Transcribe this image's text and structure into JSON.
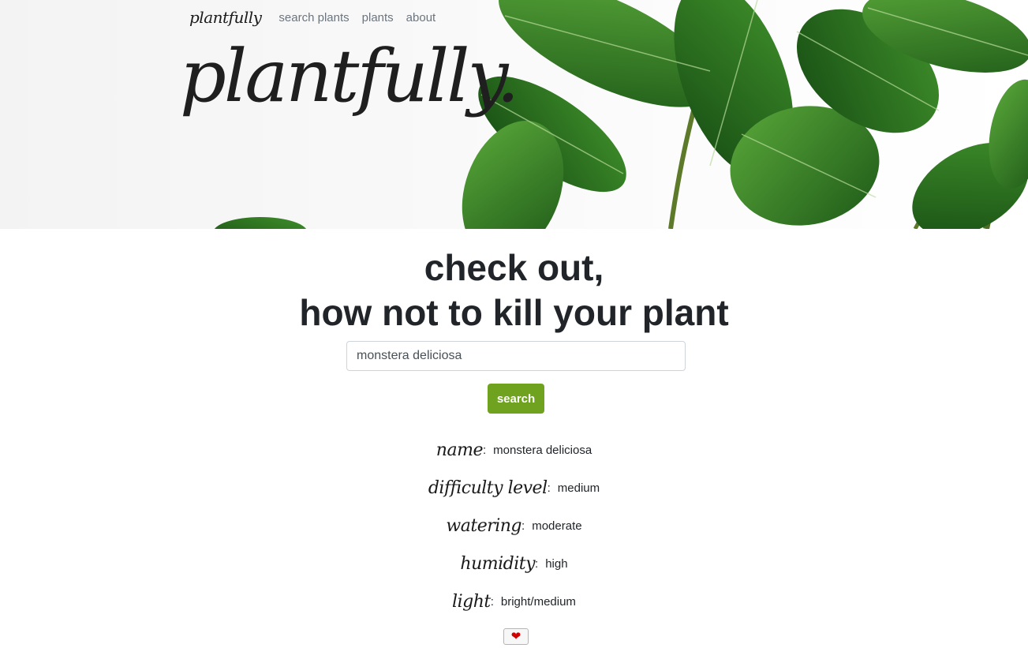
{
  "nav": {
    "brand": "plantfully",
    "links": [
      "search plants",
      "plants",
      "about"
    ]
  },
  "hero": {
    "title": "plantfully."
  },
  "headline": {
    "line1": "check out,",
    "line2": "how not to kill your plant"
  },
  "search": {
    "value": "monstera deliciosa",
    "button_label": "search"
  },
  "details": [
    {
      "label": "name",
      "value": "monstera deliciosa"
    },
    {
      "label": "difficulty level",
      "value": "medium"
    },
    {
      "label": "watering",
      "value": "moderate"
    },
    {
      "label": "humidity",
      "value": "high"
    },
    {
      "label": "light",
      "value": "bright/medium"
    }
  ],
  "favorite": {
    "icon": "heart-icon",
    "color": "#d10000"
  },
  "colors": {
    "accent": "#6fa21f",
    "leaf_dark": "#1f5e1a",
    "leaf_light": "#4f9a2f"
  }
}
